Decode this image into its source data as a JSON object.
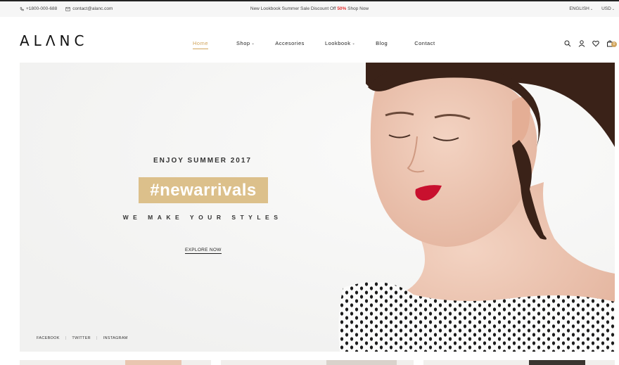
{
  "topbar": {
    "phone": "+1800-000-688",
    "email": "contact@alanc.com",
    "promo_before": "New Lookbook Summer Sale Discount Off ",
    "promo_highlight": "50%",
    "promo_after": " Shop Now",
    "language": "ENGLISH",
    "currency": "USD"
  },
  "header": {
    "logo": "ALΛNC",
    "nav": [
      "Home",
      "Shop",
      "Accesories",
      "Lookbook",
      "Blog",
      "Contact"
    ],
    "cart_count": "0"
  },
  "hero": {
    "kicker": "ENJOY SUMMER 2017",
    "tag": "#newarrivals",
    "subtitle": "WE MAKE YOUR STYLES",
    "cta": "EXPLORE NOW",
    "social": [
      "FACEBOOK",
      "TWITTER",
      "INSTAGRAM"
    ]
  },
  "colors": {
    "accent": "#d1a45c",
    "tag_bg": "#dcc08b",
    "promo_highlight": "#e23030",
    "hero_bg": "#f4f4f3"
  }
}
